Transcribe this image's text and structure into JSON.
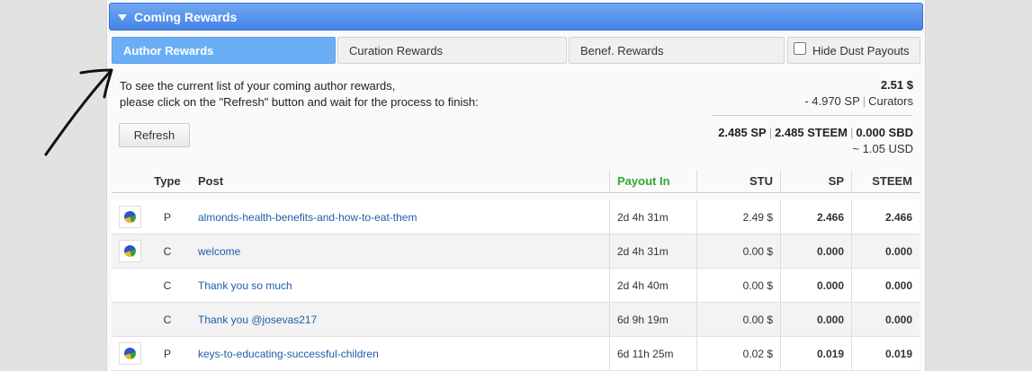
{
  "section": {
    "title": "Coming Rewards"
  },
  "tabs": [
    {
      "label": "Author Rewards",
      "active": true
    },
    {
      "label": "Curation Rewards",
      "active": false
    },
    {
      "label": "Benef. Rewards",
      "active": false
    }
  ],
  "hide_dust": {
    "label": "Hide Dust Payouts",
    "checked": false
  },
  "info": {
    "line1": "To see the current list of your coming author rewards,",
    "line2": "please click on the \"Refresh\" button and wait for the process to finish:"
  },
  "summary": {
    "total_usd": "2.51 $",
    "curators_sp": "- 4.970 SP",
    "curators_label": "Curators",
    "sp": "2.485 SP",
    "steem": "2.485 STEEM",
    "sbd": "0.000 SBD",
    "usd_approx": "~ 1.05 USD"
  },
  "refresh_label": "Refresh",
  "columns": {
    "type": "Type",
    "post": "Post",
    "payout": "Payout In",
    "stu": "STU",
    "sp": "SP",
    "steem": "STEEM"
  },
  "rows": [
    {
      "icon": true,
      "type": "P",
      "post": "almonds-health-benefits-and-how-to-eat-them",
      "payout": "2d 4h 31m",
      "stu": "2.49 $",
      "sp": "2.466",
      "steem": "2.466"
    },
    {
      "icon": true,
      "type": "C",
      "post": "welcome",
      "payout": "2d 4h 31m",
      "stu": "0.00 $",
      "sp": "0.000",
      "steem": "0.000"
    },
    {
      "icon": false,
      "type": "C",
      "post": "Thank you so much",
      "payout": "2d 4h 40m",
      "stu": "0.00 $",
      "sp": "0.000",
      "steem": "0.000"
    },
    {
      "icon": false,
      "type": "C",
      "post": "Thank you @josevas217",
      "payout": "6d 9h 19m",
      "stu": "0.00 $",
      "sp": "0.000",
      "steem": "0.000"
    },
    {
      "icon": true,
      "type": "P",
      "post": "keys-to-educating-successful-children",
      "payout": "6d 11h 25m",
      "stu": "0.02 $",
      "sp": "0.019",
      "steem": "0.019"
    }
  ],
  "icons": {
    "row_icon": "pie-chart-icon",
    "collapse": "triangle-down-icon",
    "annotation": "hand-drawn-arrow-icon"
  }
}
